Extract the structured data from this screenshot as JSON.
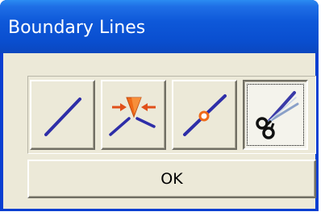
{
  "window": {
    "title": "Boundary Lines"
  },
  "tools": [
    {
      "name": "line-tool",
      "icon": "straight-line-icon"
    },
    {
      "name": "join-tool",
      "icon": "line-join-arrows-icon"
    },
    {
      "name": "split-point-tool",
      "icon": "line-with-point-icon"
    },
    {
      "name": "cut-tool",
      "icon": "scissors-cut-icon",
      "selected": true
    }
  ],
  "buttons": {
    "ok_label": "OK"
  },
  "colors": {
    "titlebar": "#0a4fd0",
    "dialog_face": "#ece9d8",
    "line": "#2e2ea8",
    "accent_orange": "#f06a18"
  }
}
